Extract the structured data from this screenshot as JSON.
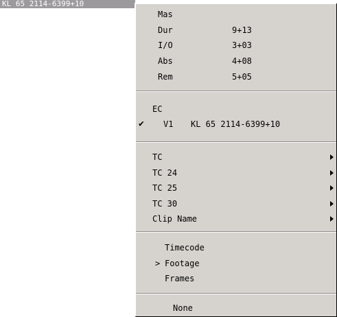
{
  "field": {
    "text": "KL 65 2114-6399+10"
  },
  "menu": {
    "durations": [
      {
        "label": "Mas",
        "value": ""
      },
      {
        "label": "Dur",
        "value": "9+13"
      },
      {
        "label": "I/O",
        "value": "3+03"
      },
      {
        "label": "Abs",
        "value": "4+08"
      },
      {
        "label": "Rem",
        "value": "5+05"
      }
    ],
    "ec": {
      "label": "EC",
      "track": "V1",
      "track_value": "KL 65 2114-6399+10",
      "check": "✔"
    },
    "submenus": [
      {
        "label": "TC"
      },
      {
        "label": "TC 24"
      },
      {
        "label": "TC 25"
      },
      {
        "label": "TC 30"
      },
      {
        "label": "Clip Name"
      }
    ],
    "formats": {
      "marker": ">",
      "items": [
        "Timecode",
        "Footage",
        "Frames"
      ],
      "selected": "Footage"
    },
    "none_label": "None"
  }
}
